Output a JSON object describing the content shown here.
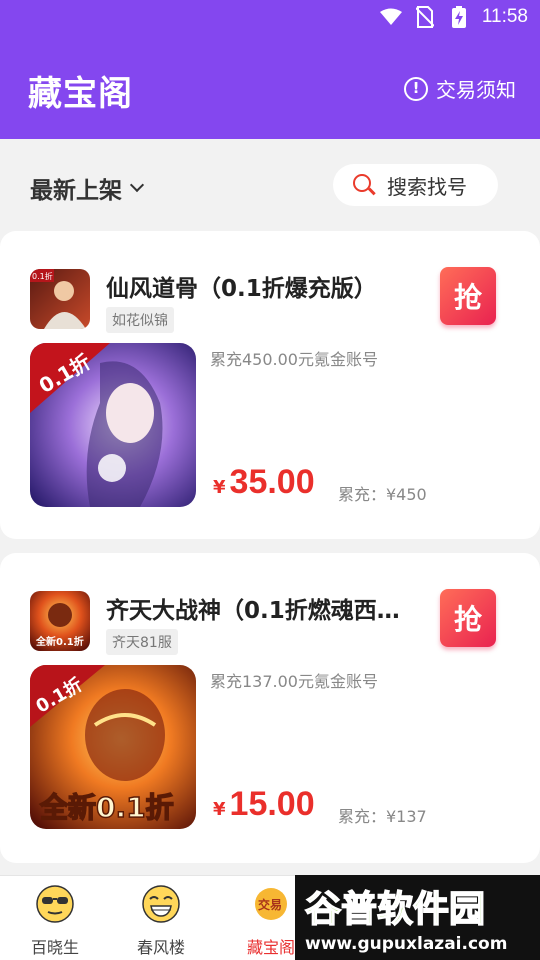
{
  "status_bar": {
    "time": "11:58",
    "icons": [
      "wifi-icon",
      "no-sim-icon",
      "battery-charging-icon"
    ]
  },
  "header": {
    "title": "藏宝阁",
    "notice_label": "交易须知",
    "notice_icon": "info-circle-icon",
    "bg_color": "#8447ef"
  },
  "filter": {
    "sort_label": "最新上架",
    "search_label": "搜索找号"
  },
  "listings": [
    {
      "game_name": "仙风道骨（0.1折爆充版）",
      "server": "如花似锦",
      "description": "累充450.00元氪金账号",
      "currency": "¥",
      "price": "35.00",
      "charged_label": "累充：¥450",
      "grab_label": "抢",
      "icon_badge": "0.1折",
      "cover_badge": "0.1折"
    },
    {
      "game_name": "齐天大战神（0.1折燃魂西…",
      "server": "齐天81服",
      "description": "累充137.00元氪金账号",
      "currency": "¥",
      "price": "15.00",
      "charged_label": "累充：¥137",
      "grab_label": "抢",
      "icon_badge": "全新0.1折",
      "cover_badge": "0.1折",
      "cover_text": "全新0.1折"
    }
  ],
  "tab_bar": {
    "tabs": [
      {
        "label": "百晓生",
        "icon": "sunglasses-emoji-icon"
      },
      {
        "label": "春风楼",
        "icon": "grinning-emoji-icon"
      },
      {
        "label": "藏宝阁",
        "icon": "trade-icon",
        "icon_text": "交易",
        "active": true
      }
    ]
  },
  "watermark": {
    "line1": "谷普软件园",
    "line2": "www.gupuxlazai.com"
  },
  "colors": {
    "accent": "#8447ef",
    "price_red": "#ea2f2b",
    "grab_gradient_start": "#ff6d58",
    "grab_gradient_end": "#e92250"
  }
}
